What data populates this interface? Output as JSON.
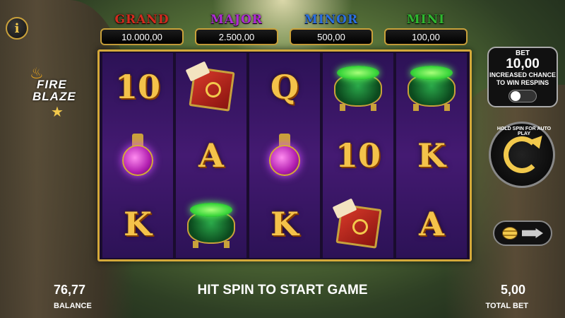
{
  "jackpots": [
    {
      "name": "GRAND",
      "value": "10.000,00",
      "color": "#d42a1e"
    },
    {
      "name": "MAJOR",
      "value": "2.500,00",
      "color": "#b02bd6"
    },
    {
      "name": "MINOR",
      "value": "500,00",
      "color": "#2a6fe0"
    },
    {
      "name": "MINI",
      "value": "100,00",
      "color": "#2fb82f"
    }
  ],
  "logo": {
    "line1": "FIRE",
    "line2": "BLAZE"
  },
  "reels": [
    [
      "10",
      "potion",
      "K"
    ],
    [
      "book",
      "A",
      "cauldron"
    ],
    [
      "Q",
      "potion",
      "K"
    ],
    [
      "cauldron",
      "10",
      "book"
    ],
    [
      "cauldron",
      "K",
      "A"
    ]
  ],
  "bet_panel": {
    "label": "BET",
    "value": "10,00",
    "description": "INCREASED CHANCE TO WIN RESPINS",
    "toggle_on": false
  },
  "spin_button": {
    "hint": "HOLD SPIN FOR AUTO PLAY"
  },
  "bottom": {
    "balance_value": "76,77",
    "balance_label": "BALANCE",
    "message": "HIT SPIN TO START GAME",
    "total_bet_value": "5,00",
    "total_bet_label": "TOTAL BET"
  }
}
